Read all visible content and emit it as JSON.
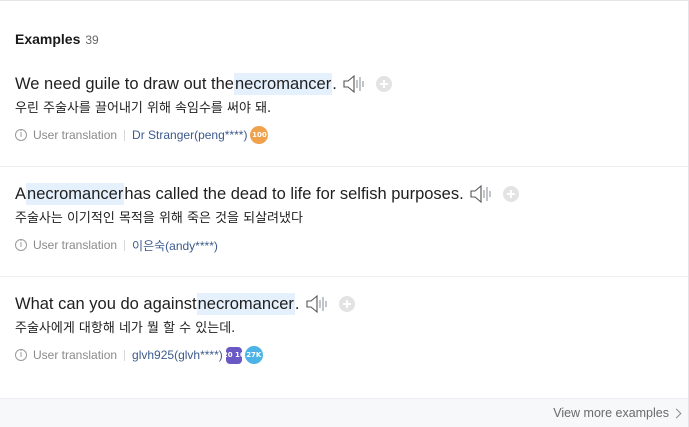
{
  "header": {
    "title": "Examples",
    "count": "39"
  },
  "examples": [
    {
      "en_before": "We need guile to draw out the ",
      "en_highlight": "necromancer",
      "en_after": ".",
      "ko": "우린 주술사를 끌어내기 위해 속임수를 써야 돼.",
      "source_label": "User translation",
      "user": "Dr Stranger(peng****)",
      "badges": [
        {
          "text": "100",
          "color": "orange"
        }
      ]
    },
    {
      "en_before": "A ",
      "en_highlight": "necromancer",
      "en_after": " has called the dead to life for selfish purposes.",
      "ko": "주술사는 이기적인 목적을 위해 죽은 것을 되살려냈다",
      "source_label": "User translation",
      "user": "이은숙(andy****)",
      "badges": []
    },
    {
      "en_before": "What can you do against ",
      "en_highlight": "necromancer",
      "en_after": ".",
      "ko": "주술사에게 대항해 네가 뭘 할 수 있는데.",
      "source_label": "User translation",
      "user": "glvh925(glvh****)",
      "badges": [
        {
          "text": "20 16",
          "color": "purple"
        },
        {
          "text": "27K",
          "color": "blue"
        }
      ]
    }
  ],
  "footer": {
    "more_label": "View more examples"
  },
  "icons": {
    "speaker": "speaker-icon",
    "add": "plus-icon",
    "info": "info-icon",
    "chevron": "chevron-right-icon"
  },
  "colors": {
    "highlight": "#e4f1fd",
    "user_link": "#3c5a8c"
  }
}
